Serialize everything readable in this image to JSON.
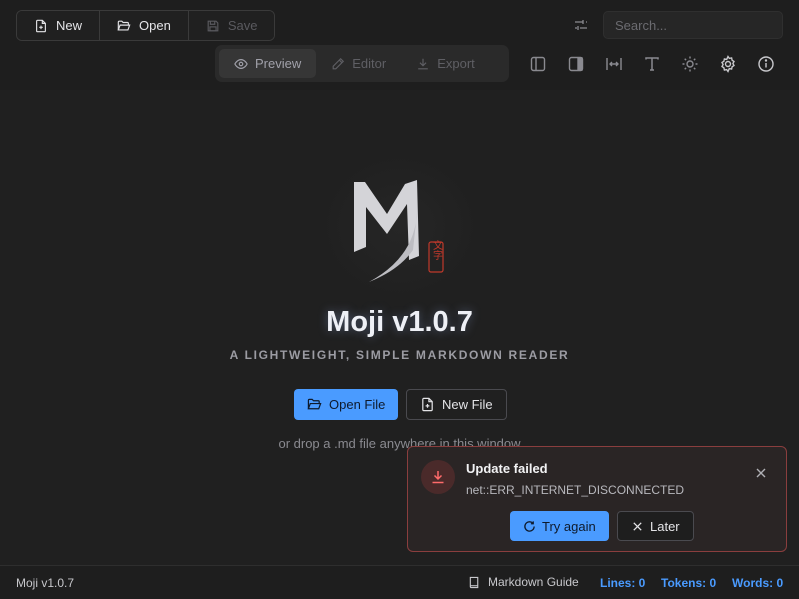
{
  "toolbar": {
    "new_label": "New",
    "open_label": "Open",
    "save_label": "Save",
    "filter_icon": "sliders-icon",
    "search_placeholder": "Search...",
    "modes": [
      {
        "label": "Preview",
        "icon": "eye-icon",
        "active": true
      },
      {
        "label": "Editor",
        "icon": "pencil-icon",
        "active": false
      },
      {
        "label": "Export",
        "icon": "download-icon",
        "active": false
      }
    ],
    "view_icons": [
      "sidebar-left-icon",
      "sidebar-right-icon",
      "fit-width-icon",
      "font-icon",
      "sun-icon",
      "gear-icon",
      "info-icon"
    ]
  },
  "welcome": {
    "title": "Moji v1.0.7",
    "subtitle": "A LIGHTWEIGHT, SIMPLE MARKDOWN READER",
    "open_file_label": "Open File",
    "new_file_label": "New File",
    "drop_hint": "or drop a .md file anywhere in this window"
  },
  "logo": {
    "stamp_text": "文字",
    "mark_color": "#d4d4d8",
    "stamp_color": "#c0392b"
  },
  "toast": {
    "title": "Update failed",
    "message": "net::ERR_INTERNET_DISCONNECTED",
    "retry_label": "Try again",
    "later_label": "Later"
  },
  "status": {
    "version": "Moji v1.0.7",
    "guide_label": "Markdown Guide",
    "lines": "Lines: 0",
    "tokens": "Tokens: 0",
    "words": "Words: 0"
  },
  "colors": {
    "accent": "#4a9bff",
    "background": "#202020",
    "error_border": "#8a3e3e"
  }
}
